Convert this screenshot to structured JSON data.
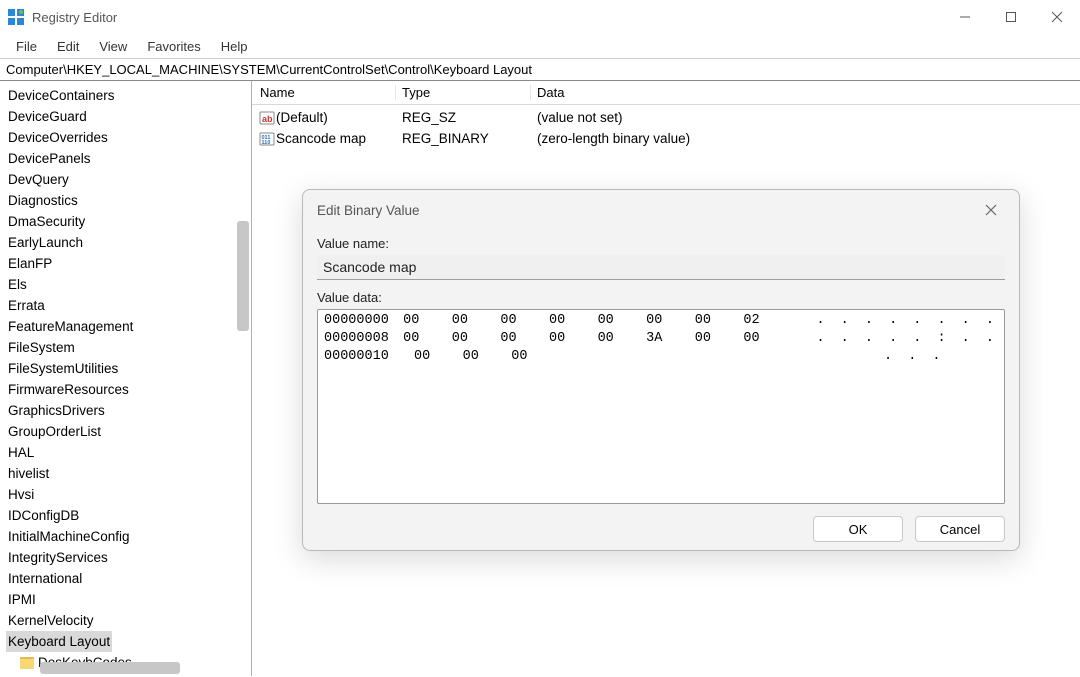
{
  "window": {
    "title": "Registry Editor"
  },
  "menu": {
    "file": "File",
    "edit": "Edit",
    "view": "View",
    "favorites": "Favorites",
    "help": "Help"
  },
  "address": "Computer\\HKEY_LOCAL_MACHINE\\SYSTEM\\CurrentControlSet\\Control\\Keyboard Layout",
  "tree": {
    "items": [
      "DeviceContainers",
      "DeviceGuard",
      "DeviceOverrides",
      "DevicePanels",
      "DevQuery",
      "Diagnostics",
      "DmaSecurity",
      "EarlyLaunch",
      "ElanFP",
      "Els",
      "Errata",
      "FeatureManagement",
      "FileSystem",
      "FileSystemUtilities",
      "FirmwareResources",
      "GraphicsDrivers",
      "GroupOrderList",
      "HAL",
      "hivelist",
      "Hvsi",
      "IDConfigDB",
      "InitialMachineConfig",
      "IntegrityServices",
      "International",
      "IPMI",
      "KernelVelocity",
      "Keyboard Layout"
    ],
    "selected": "Keyboard Layout",
    "child": "DosKeybCodes"
  },
  "list": {
    "headers": {
      "name": "Name",
      "type": "Type",
      "data": "Data"
    },
    "rows": [
      {
        "icon": "string-icon",
        "name": "(Default)",
        "type": "REG_SZ",
        "data": "(value not set)"
      },
      {
        "icon": "binary-icon",
        "name": "Scancode map",
        "type": "REG_BINARY",
        "data": "(zero-length binary value)"
      }
    ]
  },
  "dialog": {
    "title": "Edit Binary Value",
    "name_label": "Value name:",
    "name_value": "Scancode map",
    "data_label": "Value data:",
    "hex_rows": [
      {
        "offset": "00000000",
        "bytes": "00   00   00   00   00   00   00   02",
        "ascii": ". . . . . . . ."
      },
      {
        "offset": "00000008",
        "bytes": "00   00   00   00   00   3A   00   00",
        "ascii": ". . . . . : . ."
      },
      {
        "offset": "00000010",
        "bytes": "00   00   00",
        "ascii": ". . ."
      }
    ],
    "ok": "OK",
    "cancel": "Cancel"
  }
}
